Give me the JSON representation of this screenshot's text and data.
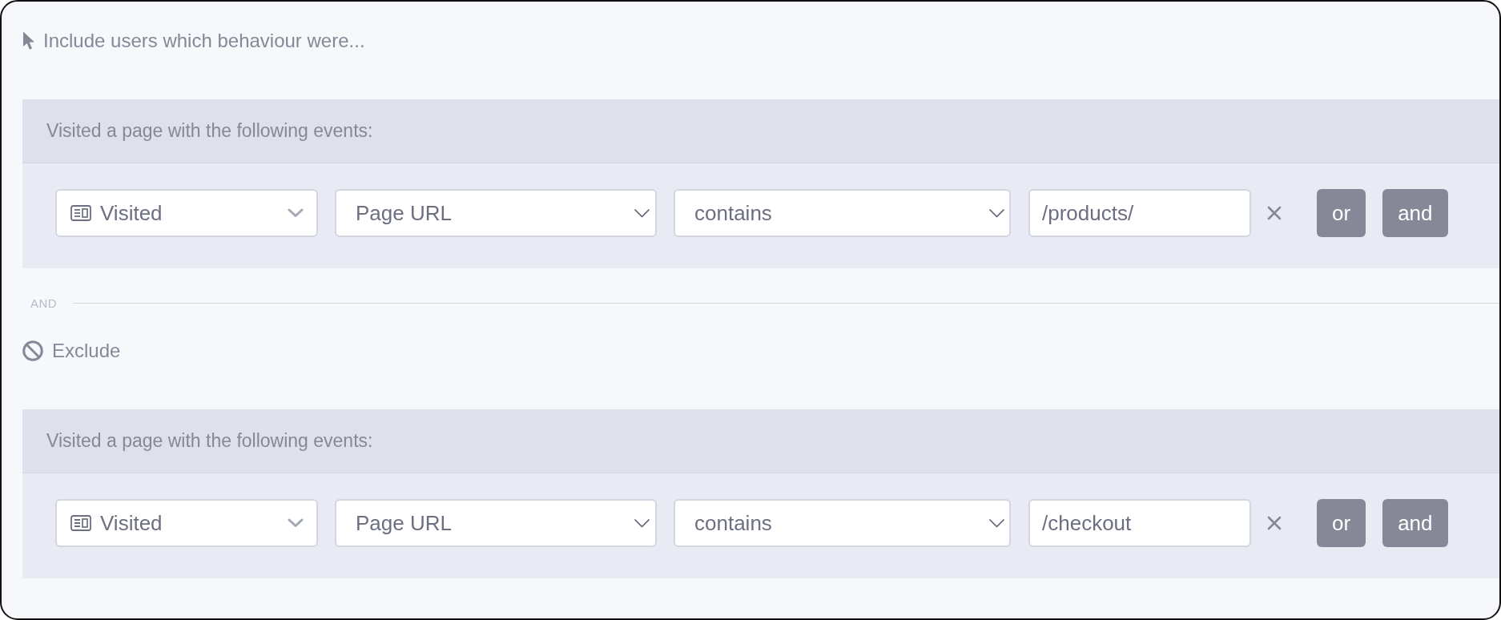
{
  "sections": [
    {
      "kind": "include",
      "heading": "Include users which behaviour were...",
      "group": {
        "title": "Visited a page with the following events:",
        "conditions": [
          {
            "event": "Visited",
            "property": "Page URL",
            "operator": "contains",
            "value": "/products/",
            "buttons": [
              "or",
              "and"
            ]
          }
        ]
      }
    },
    {
      "kind": "exclude",
      "separator": "AND",
      "heading": "Exclude",
      "group": {
        "title": "Visited a page with the following events:",
        "conditions": [
          {
            "event": "Visited",
            "property": "Page URL",
            "operator": "contains",
            "value": "/checkout",
            "buttons": [
              "or",
              "and"
            ]
          }
        ]
      }
    }
  ]
}
